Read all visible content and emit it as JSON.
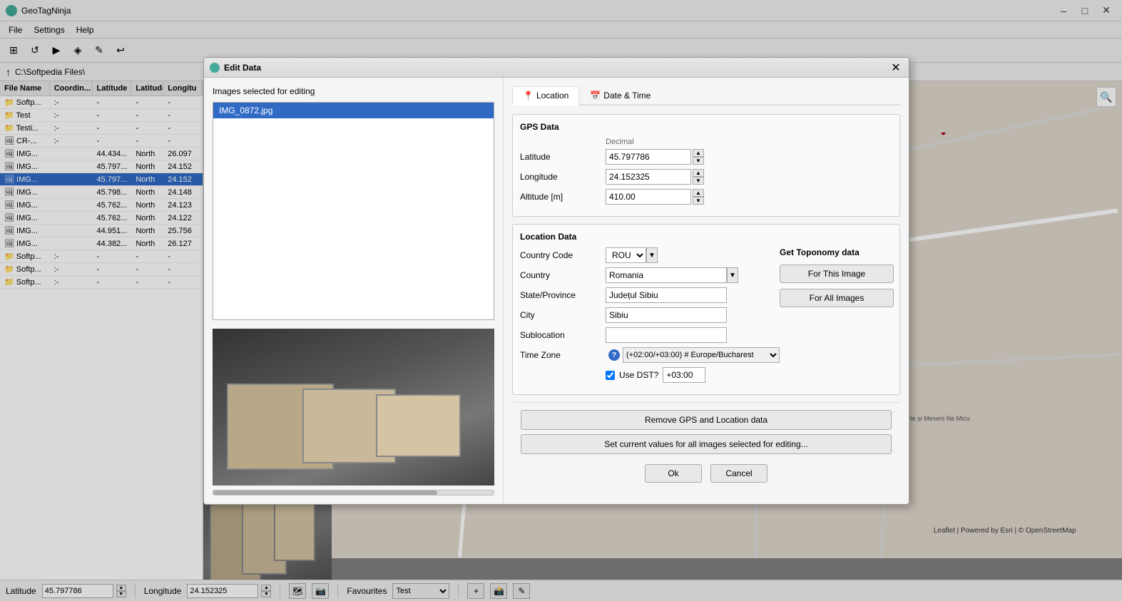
{
  "app": {
    "title": "GeoTagNinja",
    "path": "C:\\Softpedia Files\\"
  },
  "menu": {
    "items": [
      "File",
      "Settings",
      "Help"
    ]
  },
  "toolbar": {
    "buttons": [
      "⊞",
      "↺",
      "▶",
      "◈",
      "✎",
      "↩"
    ]
  },
  "file_list": {
    "columns": [
      "File Name",
      "Coordin...",
      "Latitude",
      "Latitude...",
      "Longitu"
    ],
    "rows": [
      {
        "name": "Softp...",
        "coord": ":-",
        "lat": "-",
        "latn": "-",
        "long": "-",
        "type": "folder"
      },
      {
        "name": "Test",
        "coord": ":-",
        "lat": "-",
        "latn": "-",
        "long": "-",
        "type": "folder"
      },
      {
        "name": "Testi...",
        "coord": ":-",
        "lat": "-",
        "latn": "-",
        "long": "-",
        "type": "folder"
      },
      {
        "name": "CR-...",
        "coord": ":-",
        "lat": "-",
        "latn": "-",
        "long": "-",
        "type": "file"
      },
      {
        "name": "IMG...",
        "coord": "",
        "lat": "44.434...",
        "latn": "North",
        "long": "26.097",
        "type": "file"
      },
      {
        "name": "IMG...",
        "coord": "",
        "lat": "45.797...",
        "latn": "North",
        "long": "24.152",
        "type": "file"
      },
      {
        "name": "IMG...",
        "coord": "",
        "lat": "45.797...",
        "latn": "North",
        "long": "24.152",
        "type": "file",
        "selected": true
      },
      {
        "name": "IMG...",
        "coord": "",
        "lat": "45.798...",
        "latn": "North",
        "long": "24.148",
        "type": "file"
      },
      {
        "name": "IMG...",
        "coord": "",
        "lat": "45.762...",
        "latn": "North",
        "long": "24.123",
        "type": "file"
      },
      {
        "name": "IMG...",
        "coord": "",
        "lat": "45.762...",
        "latn": "North",
        "long": "24.122",
        "type": "file"
      },
      {
        "name": "IMG...",
        "coord": "",
        "lat": "44.951...",
        "latn": "North",
        "long": "25.756",
        "type": "file"
      },
      {
        "name": "IMG...",
        "coord": "",
        "lat": "44.382...",
        "latn": "North",
        "long": "26.127",
        "type": "file"
      },
      {
        "name": "Softp...",
        "coord": ":-",
        "lat": "-",
        "latn": "-",
        "long": "-",
        "type": "folder"
      },
      {
        "name": "Softp...",
        "coord": ":-",
        "lat": "-",
        "latn": "-",
        "long": "-",
        "type": "folder"
      },
      {
        "name": "Softp...",
        "coord": ":-",
        "lat": "-",
        "latn": "-",
        "long": "-",
        "type": "folder"
      }
    ]
  },
  "dialog": {
    "title": "Edit Data",
    "images_label": "Images selected for editing",
    "image_file": "IMG_0872.jpg",
    "tabs": [
      {
        "id": "location",
        "label": "Location",
        "icon": "📍",
        "active": true
      },
      {
        "id": "datetime",
        "label": "Date & Time",
        "icon": "📅",
        "active": false
      }
    ],
    "gps_section": {
      "title": "GPS Data",
      "decimal_label": "Decimal",
      "latitude_label": "Latitude",
      "latitude_value": "45.797786",
      "longitude_label": "Longitude",
      "longitude_value": "24.152325",
      "altitude_label": "Altitude [m]",
      "altitude_value": "410.00"
    },
    "location_section": {
      "title": "Location Data",
      "country_code_label": "Country Code",
      "country_code_value": "ROU",
      "country_label": "Country",
      "country_value": "Romania",
      "state_label": "State/Province",
      "state_value": "Județul Sibiu",
      "city_label": "City",
      "city_value": "Sibiu",
      "sublocation_label": "Sublocation",
      "sublocation_value": "",
      "timezone_label": "Time Zone",
      "timezone_value": "(+02:00/+03:00) # Europe/Bucharest",
      "use_dst_label": "Use DST?",
      "dst_value": "+03:00"
    },
    "toponomy": {
      "title": "Get Toponomy data",
      "for_this_image": "For This Image",
      "for_all_images": "For All Images"
    },
    "buttons": {
      "remove_gps": "Remove GPS and Location data",
      "set_current": "Set current values for all images selected for editing...",
      "ok": "Ok",
      "cancel": "Cancel"
    }
  },
  "status_bar": {
    "latitude_label": "Latitude",
    "latitude_value": "45.797786",
    "longitude_label": "Longitude",
    "longitude_value": "24.152325",
    "favourites_label": "Favourites",
    "favourites_value": "Test"
  }
}
